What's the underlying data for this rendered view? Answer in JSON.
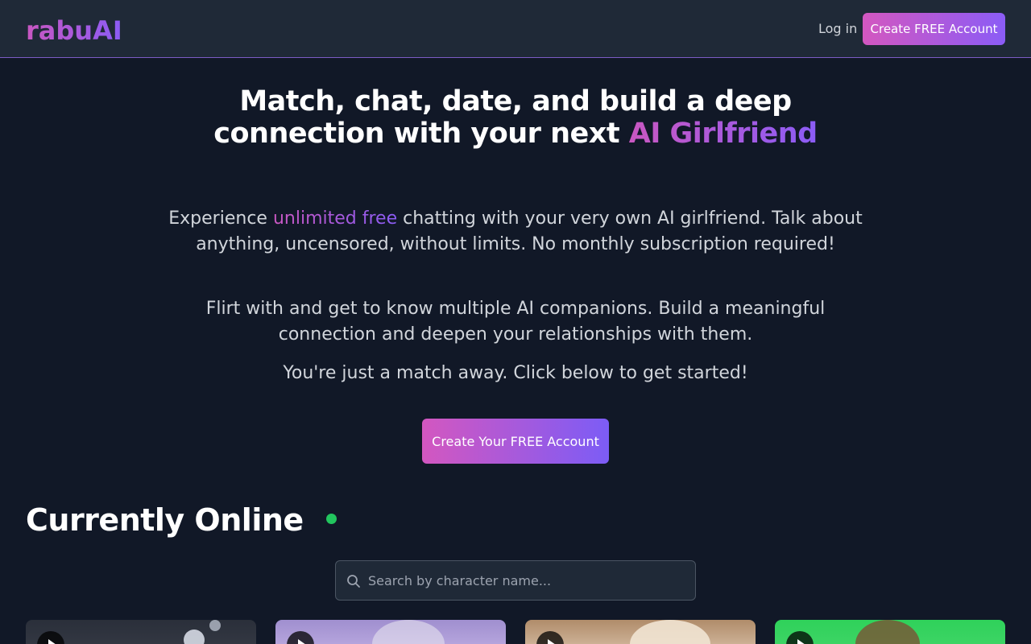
{
  "header": {
    "logo": "rabuAI",
    "login_label": "Log in",
    "cta_label": "Create FREE Account"
  },
  "hero": {
    "title_line1": "Match, chat, date, and build a deep",
    "title_line2": "connection with your next ",
    "title_highlight": "AI Girlfriend",
    "p1_before": "Experience ",
    "p1_highlight": "unlimited free",
    "p1_after": " chatting with your very own AI girlfriend. Talk about anything, uncensored, without limits. No monthly subscription required!",
    "p2": "Flirt with and get to know multiple AI companions. Build a meaningful connection and deepen your relationships with them.",
    "p3": "You're just a match away. Click below to get started!",
    "cta_label": "Create Your FREE Account"
  },
  "online": {
    "title": "Currently Online",
    "search_placeholder": "Search by character name..."
  },
  "colors": {
    "background": "#111827",
    "header_bg": "#1f2937",
    "accent_start": "#c957c1",
    "accent_end": "#8b5cf6",
    "online_dot": "#22c55e"
  },
  "icons": {
    "search": "search-icon",
    "play": "play-icon",
    "online": "online-status-dot"
  }
}
